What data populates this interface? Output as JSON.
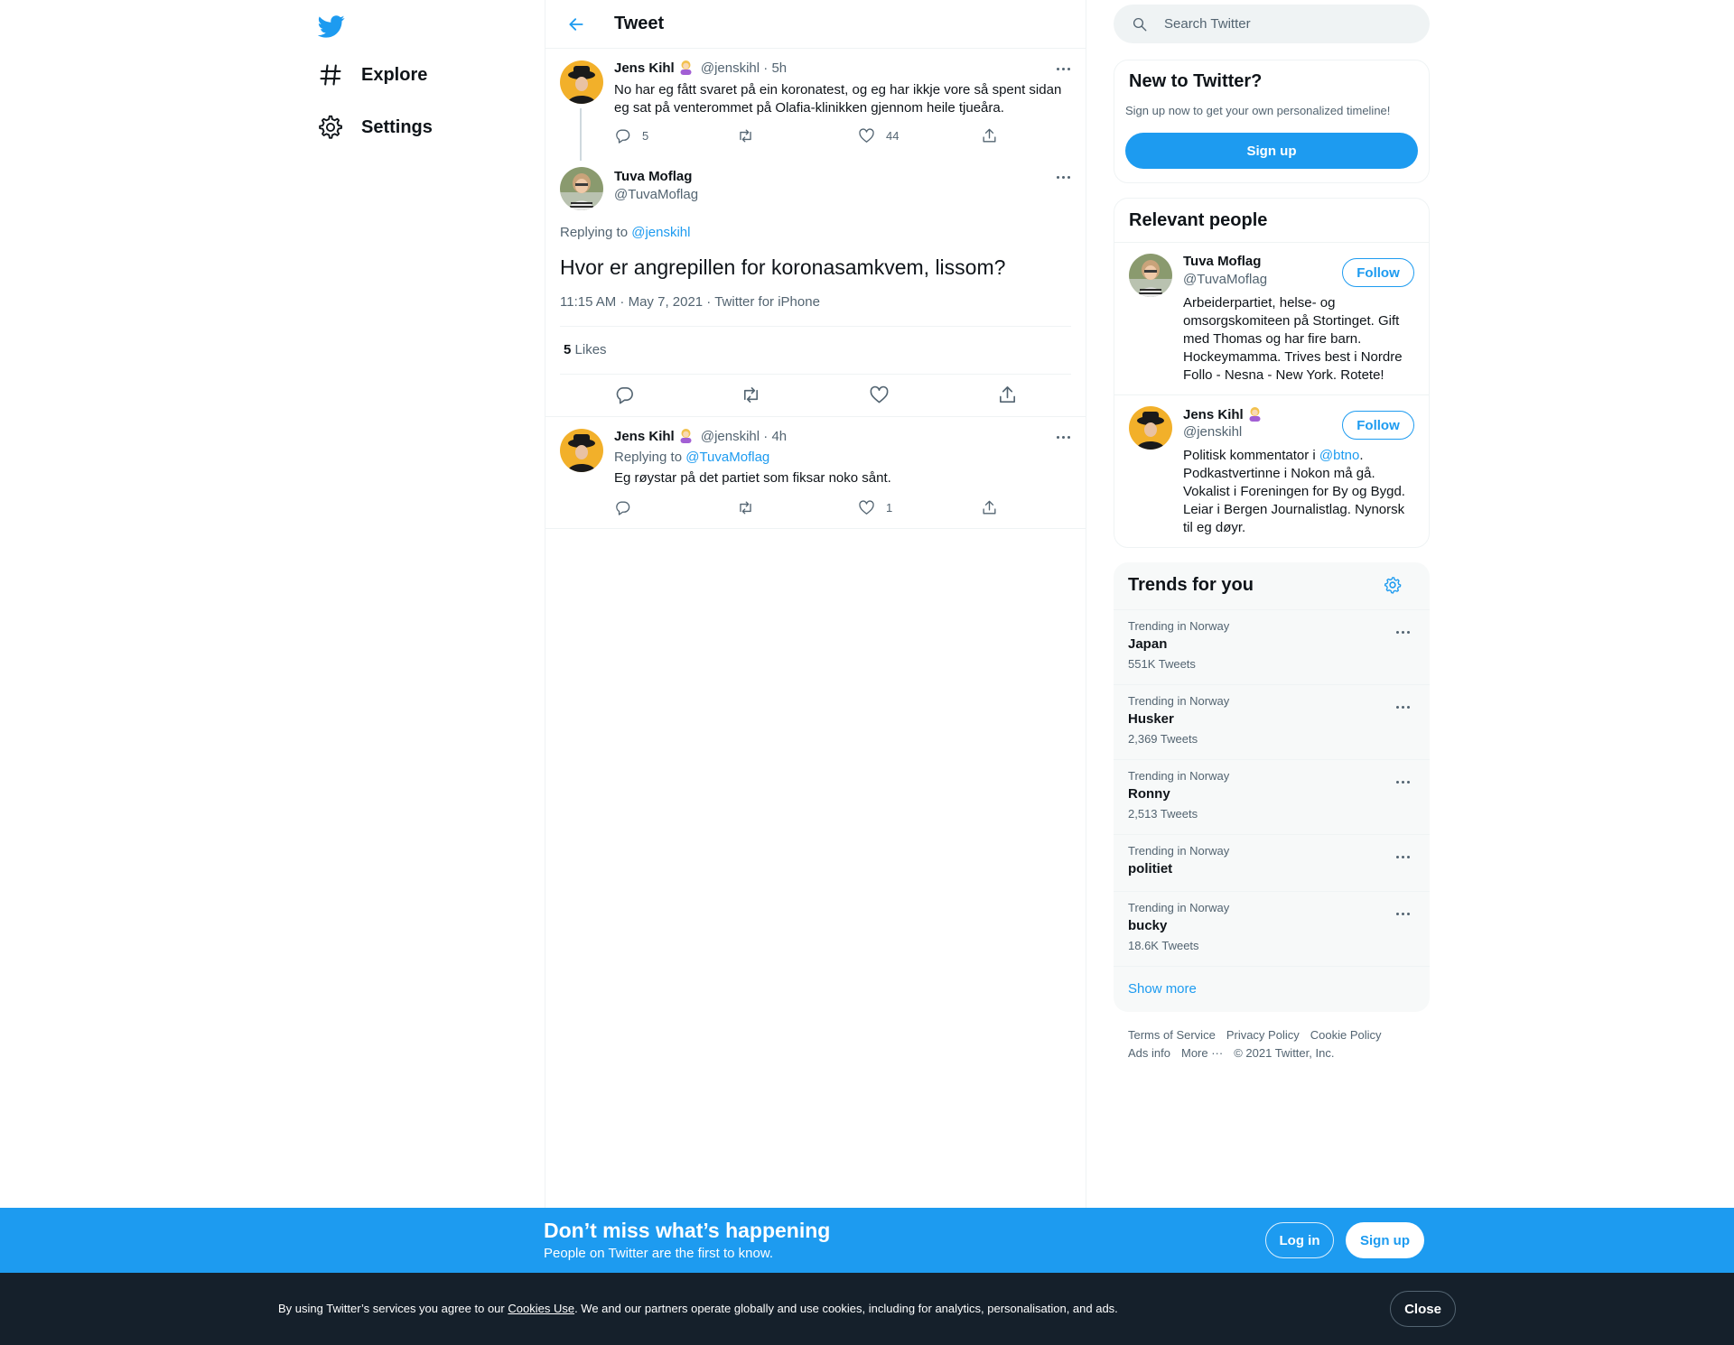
{
  "nav": {
    "items": [
      {
        "label": "Explore",
        "icon": "hashtag-icon"
      },
      {
        "label": "Settings",
        "icon": "gear-icon"
      }
    ]
  },
  "header": {
    "title": "Tweet"
  },
  "thread": {
    "parent": {
      "name": "Jens Kihl",
      "handle": "@jenskihl",
      "time": "· 5h",
      "text": "No har eg fått svaret på ein koronatest, og eg har ikkje vore så spent sidan eg sat på venterommet på Olafia-klinikken gjennom heile tjueåra.",
      "replies": "5",
      "likes": "44"
    },
    "main": {
      "name": "Tuva Moflag",
      "handle": "@TuvaMoflag",
      "replying_prefix": "Replying to",
      "replying_to": "@jenskihl",
      "text": "Hvor er angrepillen for koronasamkvem, lissom?",
      "meta": "11:15 AM · May 7, 2021 · Twitter for iPhone",
      "likes_count": "5",
      "likes_label": "Likes"
    },
    "reply": {
      "name": "Jens Kihl",
      "handle": "@jenskihl",
      "time": "· 4h",
      "replying_prefix": "Replying to",
      "replying_to": "@TuvaMoflag",
      "text": "Eg røystar på det partiet som fiksar noko sånt.",
      "likes": "1"
    }
  },
  "search": {
    "placeholder": "Search Twitter"
  },
  "new_to_twitter": {
    "title": "New to Twitter?",
    "subtitle": "Sign up now to get your own personalized timeline!",
    "signup_label": "Sign up"
  },
  "relevant_people": {
    "title": "Relevant people",
    "people": [
      {
        "name": "Tuva Moflag",
        "handle": "@TuvaMoflag",
        "follow_label": "Follow",
        "bio": "Arbeiderpartiet, helse- og omsorgskomiteen på Stortinget. Gift med Thomas og har fire barn. Hockeymamma. Trives best i Nordre Follo - Nesna - New York. Rotete!"
      },
      {
        "name": "Jens Kihl",
        "handle": "@jenskihl",
        "follow_label": "Follow",
        "bio_prefix": "Politisk kommentator i ",
        "bio_mention": "@btno",
        "bio_suffix": ". Podkastvertinne i Nokon må gå. Vokalist i Foreningen for By og Bygd. Leiar i Bergen Journalistlag. Nynorsk til eg døyr."
      }
    ]
  },
  "trends": {
    "title": "Trends for you",
    "items": [
      {
        "context": "Trending in Norway",
        "name": "Japan",
        "count": "551K Tweets"
      },
      {
        "context": "Trending in Norway",
        "name": "Husker",
        "count": "2,369 Tweets"
      },
      {
        "context": "Trending in Norway",
        "name": "Ronny",
        "count": "2,513 Tweets"
      },
      {
        "context": "Trending in Norway",
        "name": "politiet",
        "count": ""
      },
      {
        "context": "Trending in Norway",
        "name": "bucky",
        "count": "18.6K Tweets"
      }
    ],
    "show_more": "Show more"
  },
  "footer": {
    "links_row1": [
      "Terms of Service",
      "Privacy Policy",
      "Cookie Policy"
    ],
    "ads_info": "Ads info",
    "more": "More ···",
    "copyright": "© 2021 Twitter, Inc."
  },
  "banner": {
    "title": "Don’t miss what’s happening",
    "subtitle": "People on Twitter are the first to know.",
    "login_label": "Log in",
    "signup_label": "Sign up"
  },
  "cookie": {
    "prefix": "By using Twitter’s services you agree to our ",
    "link": "Cookies Use",
    "suffix": ". We and our partners operate globally and use cookies, including for analytics, personalisation, and ads.",
    "close_label": "Close"
  },
  "colors": {
    "accent": "#1d9bf0",
    "dark": "#15202b",
    "muted": "#536471"
  }
}
